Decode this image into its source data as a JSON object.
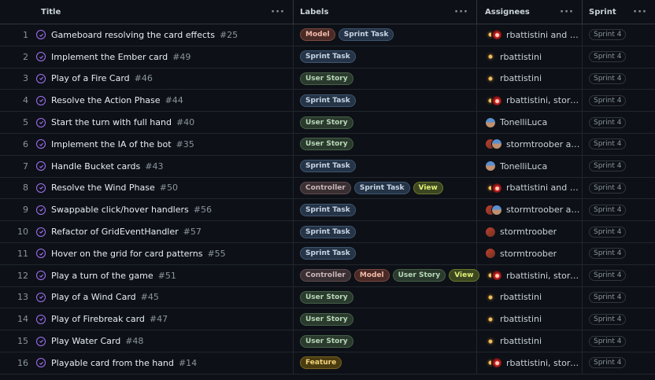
{
  "columns": {
    "title": "Title",
    "labels": "Labels",
    "assignees": "Assignees",
    "sprint": "Sprint",
    "menu": "···"
  },
  "rows": [
    {
      "num": "1",
      "title": "Gameboard resolving the card effects",
      "issue": "#25",
      "labels": [
        {
          "text": "Model",
          "kind": "model"
        },
        {
          "text": "Sprint Task",
          "kind": "sprint"
        }
      ],
      "avatars": [
        "dark",
        "red"
      ],
      "assignees": "rbattistini and st...",
      "sprint": "Sprint 4"
    },
    {
      "num": "2",
      "title": "Implement the Ember card",
      "issue": "#49",
      "labels": [
        {
          "text": "Sprint Task",
          "kind": "sprint"
        }
      ],
      "avatars": [
        "dark"
      ],
      "assignees": "rbattistini",
      "sprint": "Sprint 4"
    },
    {
      "num": "3",
      "title": "Play of a Fire Card",
      "issue": "#46",
      "labels": [
        {
          "text": "User Story",
          "kind": "story"
        }
      ],
      "avatars": [
        "dark"
      ],
      "assignees": "rbattistini",
      "sprint": "Sprint 4"
    },
    {
      "num": "4",
      "title": "Resolve the Action Phase",
      "issue": "#44",
      "labels": [
        {
          "text": "Sprint Task",
          "kind": "sprint"
        }
      ],
      "avatars": [
        "dark",
        "red"
      ],
      "assignees": "rbattistini, storm...",
      "sprint": "Sprint 4"
    },
    {
      "num": "5",
      "title": "Start the turn with full hand",
      "issue": "#40",
      "labels": [
        {
          "text": "User Story",
          "kind": "story"
        }
      ],
      "avatars": [
        "blue"
      ],
      "assignees": "TonelliLuca",
      "sprint": "Sprint 4"
    },
    {
      "num": "6",
      "title": "Implement the IA of the bot",
      "issue": "#35",
      "labels": [
        {
          "text": "User Story",
          "kind": "story"
        }
      ],
      "avatars": [
        "brick",
        "blue"
      ],
      "assignees": "stormtroober an...",
      "sprint": "Sprint 4"
    },
    {
      "num": "7",
      "title": "Handle Bucket cards",
      "issue": "#43",
      "labels": [
        {
          "text": "Sprint Task",
          "kind": "sprint"
        }
      ],
      "avatars": [
        "blue"
      ],
      "assignees": "TonelliLuca",
      "sprint": "Sprint 4"
    },
    {
      "num": "8",
      "title": "Resolve the Wind Phase",
      "issue": "#50",
      "labels": [
        {
          "text": "Controller",
          "kind": "controller"
        },
        {
          "text": "Sprint Task",
          "kind": "sprint"
        },
        {
          "text": "View",
          "kind": "view"
        }
      ],
      "avatars": [
        "dark",
        "red"
      ],
      "assignees": "rbattistini and st...",
      "sprint": "Sprint 4"
    },
    {
      "num": "9",
      "title": "Swappable click/hover handlers",
      "issue": "#56",
      "labels": [
        {
          "text": "Sprint Task",
          "kind": "sprint"
        }
      ],
      "avatars": [
        "brick",
        "blue"
      ],
      "assignees": "stormtroober an...",
      "sprint": "Sprint 4"
    },
    {
      "num": "10",
      "title": "Refactor of GridEventHandler",
      "issue": "#57",
      "labels": [
        {
          "text": "Sprint Task",
          "kind": "sprint"
        }
      ],
      "avatars": [
        "brick"
      ],
      "assignees": "stormtroober",
      "sprint": "Sprint 4"
    },
    {
      "num": "11",
      "title": "Hover on the grid for card patterns",
      "issue": "#55",
      "labels": [
        {
          "text": "Sprint Task",
          "kind": "sprint"
        }
      ],
      "avatars": [
        "brick"
      ],
      "assignees": "stormtroober",
      "sprint": "Sprint 4"
    },
    {
      "num": "12",
      "title": "Play a turn of the game",
      "issue": "#51",
      "labels": [
        {
          "text": "Controller",
          "kind": "controller"
        },
        {
          "text": "Model",
          "kind": "model"
        },
        {
          "text": "User Story",
          "kind": "story"
        },
        {
          "text": "View",
          "kind": "view"
        }
      ],
      "avatars": [
        "dark",
        "red"
      ],
      "assignees": "rbattistini, storm...",
      "sprint": "Sprint 4"
    },
    {
      "num": "13",
      "title": "Play of a Wind Card",
      "issue": "#45",
      "labels": [
        {
          "text": "User Story",
          "kind": "story"
        }
      ],
      "avatars": [
        "dark"
      ],
      "assignees": "rbattistini",
      "sprint": "Sprint 4"
    },
    {
      "num": "14",
      "title": "Play of Firebreak card",
      "issue": "#47",
      "labels": [
        {
          "text": "User Story",
          "kind": "story"
        }
      ],
      "avatars": [
        "dark"
      ],
      "assignees": "rbattistini",
      "sprint": "Sprint 4"
    },
    {
      "num": "15",
      "title": "Play Water Card",
      "issue": "#48",
      "labels": [
        {
          "text": "User Story",
          "kind": "story"
        }
      ],
      "avatars": [
        "dark"
      ],
      "assignees": "rbattistini",
      "sprint": "Sprint 4"
    },
    {
      "num": "16",
      "title": "Playable card from the hand",
      "issue": "#14",
      "labels": [
        {
          "text": "Feature",
          "kind": "feature"
        }
      ],
      "avatars": [
        "dark",
        "red"
      ],
      "assignees": "rbattistini, storm...",
      "sprint": "Sprint 4"
    }
  ],
  "colors": {
    "status_closed": "#a371f7",
    "background": "#0d1117"
  },
  "icons": {
    "status": "closed-issue-icon",
    "menu": "kebab-menu-icon"
  }
}
